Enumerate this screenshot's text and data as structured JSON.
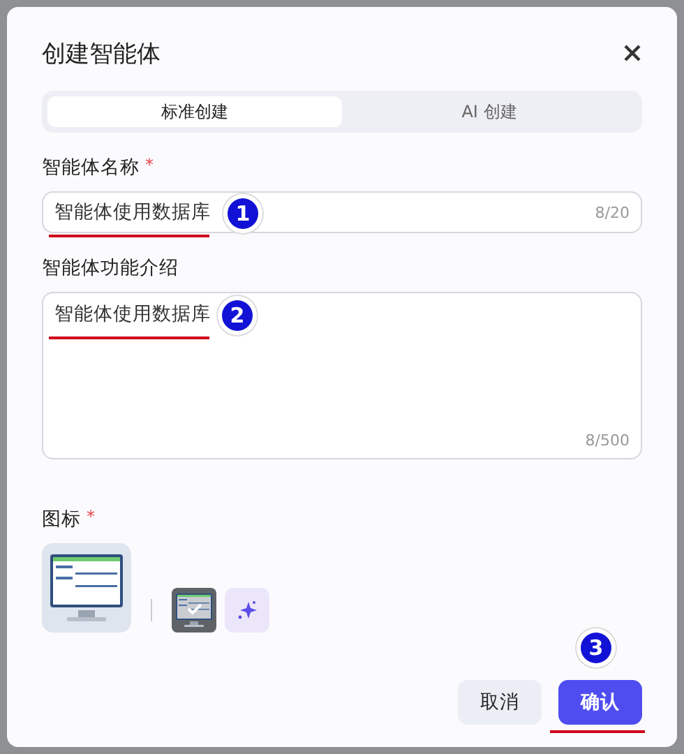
{
  "dialog": {
    "title": "创建智能体",
    "tabs": [
      {
        "label": "标准创建",
        "selected": true
      },
      {
        "label": "AI 创建",
        "selected": false
      }
    ],
    "fields": [
      {
        "kind": "input",
        "label": "智能体名称",
        "required_mark": "*",
        "value": "智能体使用数据库",
        "counter": "8/20",
        "marker": "1"
      },
      {
        "kind": "textarea",
        "label": "智能体功能介绍",
        "value": "智能体使用数据库",
        "counter": "8/500",
        "marker": "2"
      }
    ],
    "icon_section": {
      "label": "图标",
      "required_mark": "*"
    },
    "buttons": [
      {
        "label": "取消",
        "kind": "secondary"
      },
      {
        "label": "确认",
        "kind": "primary",
        "marker": "3"
      }
    ]
  }
}
